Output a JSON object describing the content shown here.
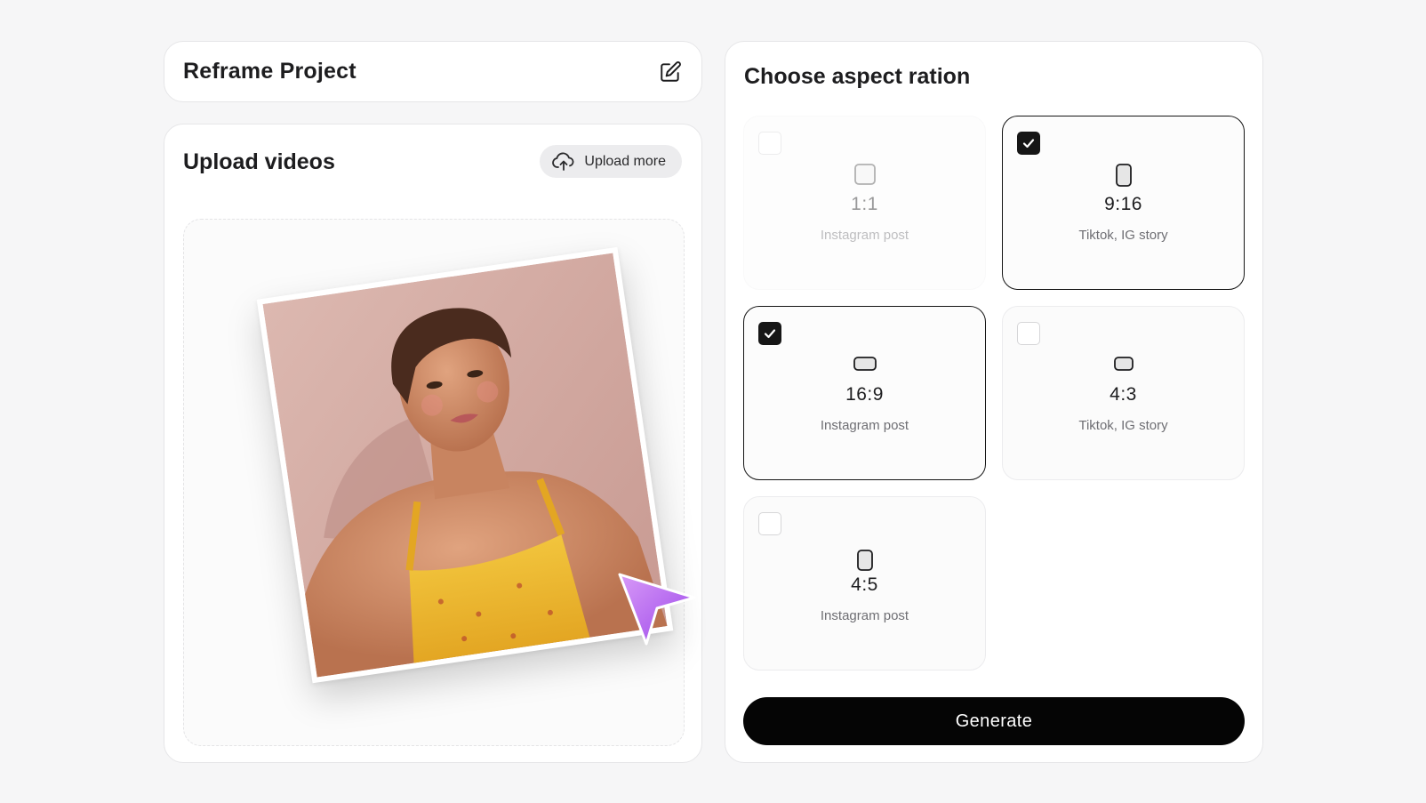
{
  "project": {
    "title": "Reframe Project",
    "edit_icon": "pencil-square-icon"
  },
  "upload": {
    "title": "Upload videos",
    "upload_more_label": "Upload more",
    "upload_icon": "cloud-upload-icon",
    "thumbnail_subject": "portrait of a short-haired woman in a yellow top against a pink wall"
  },
  "aspect": {
    "title": "Choose aspect ration",
    "options": [
      {
        "ratio": "1:1",
        "caption": "Instagram post",
        "checked": false,
        "disabled": true
      },
      {
        "ratio": "9:16",
        "caption": "Tiktok, IG story",
        "checked": true,
        "disabled": false
      },
      {
        "ratio": "16:9",
        "caption": "Instagram post",
        "checked": true,
        "disabled": false
      },
      {
        "ratio": "4:3",
        "caption": "Tiktok, IG story",
        "checked": false,
        "disabled": false
      },
      {
        "ratio": "4:5",
        "caption": "Instagram post",
        "checked": false,
        "disabled": false
      }
    ],
    "generate_label": "Generate"
  },
  "colors": {
    "accent_cursor": "#b86cf2",
    "primary_button": "#050505",
    "background": "#f6f6f7"
  }
}
